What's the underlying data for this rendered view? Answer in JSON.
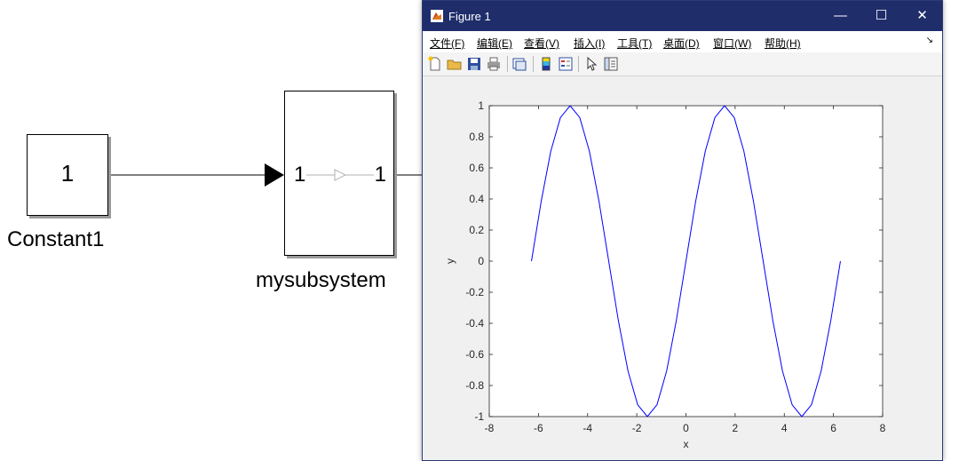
{
  "diagram": {
    "constant_block": {
      "value": "1",
      "name": "Constant1"
    },
    "subsystem_block": {
      "in_port": "1",
      "out_port": "1",
      "name": "mysubsystem"
    }
  },
  "figure": {
    "title": "Figure 1",
    "window_buttons": {
      "minimize": "—",
      "maximize": "☐",
      "close": "✕"
    },
    "menu": [
      "文件(F)",
      "编辑(E)",
      "查看(V)",
      "插入(I)",
      "工具(T)",
      "桌面(D)",
      "窗口(W)",
      "帮助(H)"
    ],
    "menu_dock": "↘",
    "toolbar_icons": [
      "new-figure-icon",
      "open-file-icon",
      "save-icon",
      "print-icon",
      "link-plot-icon",
      "colorbar-icon",
      "legend-icon",
      "pointer-icon",
      "property-inspector-icon"
    ],
    "colors": {
      "titlebar": "#1f2d6b",
      "line": "#0000ff",
      "axes_bg": "#ffffff"
    }
  },
  "chart_data": {
    "type": "line",
    "xlabel": "x",
    "ylabel": "y",
    "xlim": [
      -8,
      8
    ],
    "ylim": [
      -1,
      1
    ],
    "xticks": [
      -8,
      -6,
      -4,
      -2,
      0,
      2,
      4,
      6,
      8
    ],
    "yticks": [
      -1,
      -0.8,
      -0.6,
      -0.4,
      -0.2,
      0,
      0.2,
      0.4,
      0.6,
      0.8,
      1
    ],
    "xtick_labels": [
      "-8",
      "-6",
      "-4",
      "-2",
      "0",
      "2",
      "4",
      "6",
      "8"
    ],
    "ytick_labels": [
      "-1",
      "-0.8",
      "-0.6",
      "-0.4",
      "-0.2",
      "0",
      "0.2",
      "0.4",
      "0.6",
      "0.8",
      "1"
    ],
    "grid": false,
    "series": [
      {
        "color": "#0000ff",
        "x": [
          -6.2832,
          -5.8905,
          -5.4978,
          -5.1051,
          -4.7124,
          -4.3197,
          -3.927,
          -3.5343,
          -3.1416,
          -2.7489,
          -2.3562,
          -1.9635,
          -1.5708,
          -1.1781,
          -0.7854,
          -0.3927,
          0.0,
          0.3927,
          0.7854,
          1.1781,
          1.5708,
          1.9635,
          2.3562,
          2.7489,
          3.1416,
          3.5343,
          3.927,
          4.3197,
          4.7124,
          5.1051,
          5.4978,
          5.8905,
          6.2832
        ],
        "y": [
          0.0,
          0.3827,
          0.7071,
          0.9239,
          1.0,
          0.9239,
          0.7071,
          0.3827,
          0.0,
          -0.3827,
          -0.7071,
          -0.9239,
          -1.0,
          -0.9239,
          -0.7071,
          -0.3827,
          0.0,
          0.3827,
          0.7071,
          0.9239,
          1.0,
          0.9239,
          0.7071,
          0.3827,
          0.0,
          -0.3827,
          -0.7071,
          -0.9239,
          -1.0,
          -0.9239,
          -0.7071,
          -0.3827,
          0.0
        ]
      }
    ]
  }
}
